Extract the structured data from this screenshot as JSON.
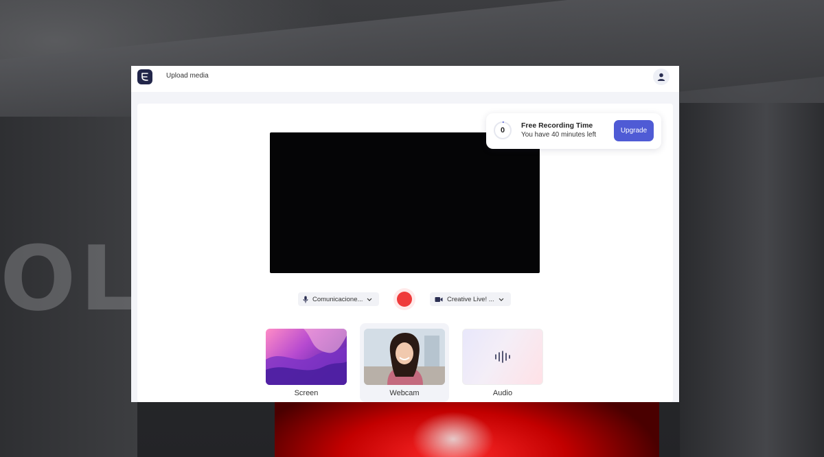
{
  "header": {
    "upload_label": "Upload media"
  },
  "quota": {
    "minutes_used": "0",
    "title": "Free Recording Time",
    "subtitle": "You have 40 minutes left",
    "upgrade_label": "Upgrade"
  },
  "devices": {
    "microphone": "Comunicacione...",
    "camera": "Creative Live! ..."
  },
  "sources": {
    "screen_label": "Screen",
    "webcam_label": "Webcam",
    "audio_label": "Audio"
  },
  "colors": {
    "accent": "#4f5bd5",
    "record": "#ef3b3b",
    "logo": "#22264a"
  },
  "icons": [
    "logo-icon",
    "user-icon",
    "microphone-icon",
    "chevron-down-icon",
    "video-camera-icon",
    "audio-waveform-icon"
  ]
}
